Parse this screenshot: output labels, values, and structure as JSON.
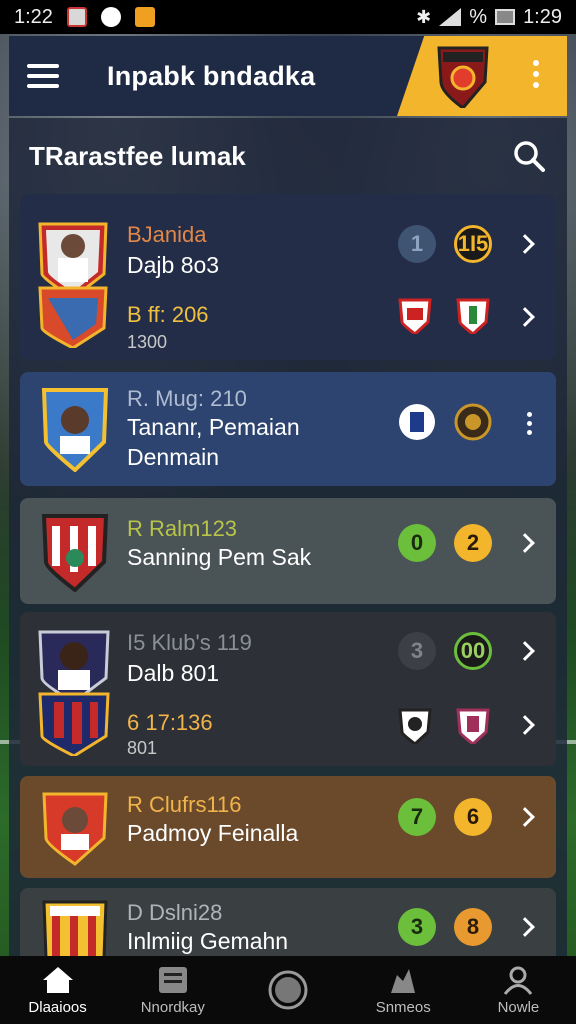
{
  "status_bar": {
    "time": "1:22",
    "battery_text": "%",
    "clock_right": "1:29"
  },
  "header": {
    "title": "Inpabk bndadka"
  },
  "panel": {
    "title": "TRarastfee lumak"
  },
  "cards": [
    {
      "line1": "BJanida",
      "line2": "Dajb 8o3",
      "line3": "B ff: 206",
      "line4": "1300",
      "badge1": "1",
      "badge2": "1I5",
      "bg": "#232d47",
      "line1_color": "#e0884a"
    },
    {
      "line1": "R. Mug: 210",
      "line2": "Tananr, Pemaian",
      "line3": "Denmain",
      "bg": "#2e4470",
      "line1_color": "#aebbd0"
    },
    {
      "line1": "R Ralm123",
      "line2": "Sanning Pem Sak",
      "badge1": "0",
      "badge2": "2",
      "bg": "#4a5356",
      "line1_color": "#b8c44a"
    },
    {
      "line1": "I5 Klub's 119",
      "line2": "Dalb 801",
      "line3": "6 17:136",
      "line4": "801",
      "badge1": "3",
      "badge2": "00",
      "bg": "#2d3036",
      "line1_color": "#8b8f96"
    },
    {
      "line1": "R Clufrs116",
      "line2": "Padmoy Feinalla",
      "badge1": "7",
      "badge2": "6",
      "bg": "#6b4a2c",
      "line1_color": "#f0b44a"
    },
    {
      "line1": "D Dslni28",
      "line2": "Inlmiig Gemahn",
      "badge1": "3",
      "badge2": "8",
      "bg": "#3a3f42",
      "line1_color": "#b0b4b8"
    }
  ],
  "bottom_nav": [
    {
      "label": "Dlaaioos",
      "icon": "home-icon"
    },
    {
      "label": "Nnordkay",
      "icon": "news-icon"
    },
    {
      "label": "",
      "icon": "record-icon"
    },
    {
      "label": "Snmeos",
      "icon": "players-icon"
    },
    {
      "label": "Nowle",
      "icon": "profile-icon"
    }
  ],
  "colors": {
    "accent": "#f2b52c",
    "header_bg": "#1f2b44",
    "badge_green": "#6bbf3a",
    "badge_yellow": "#f2b52c"
  }
}
